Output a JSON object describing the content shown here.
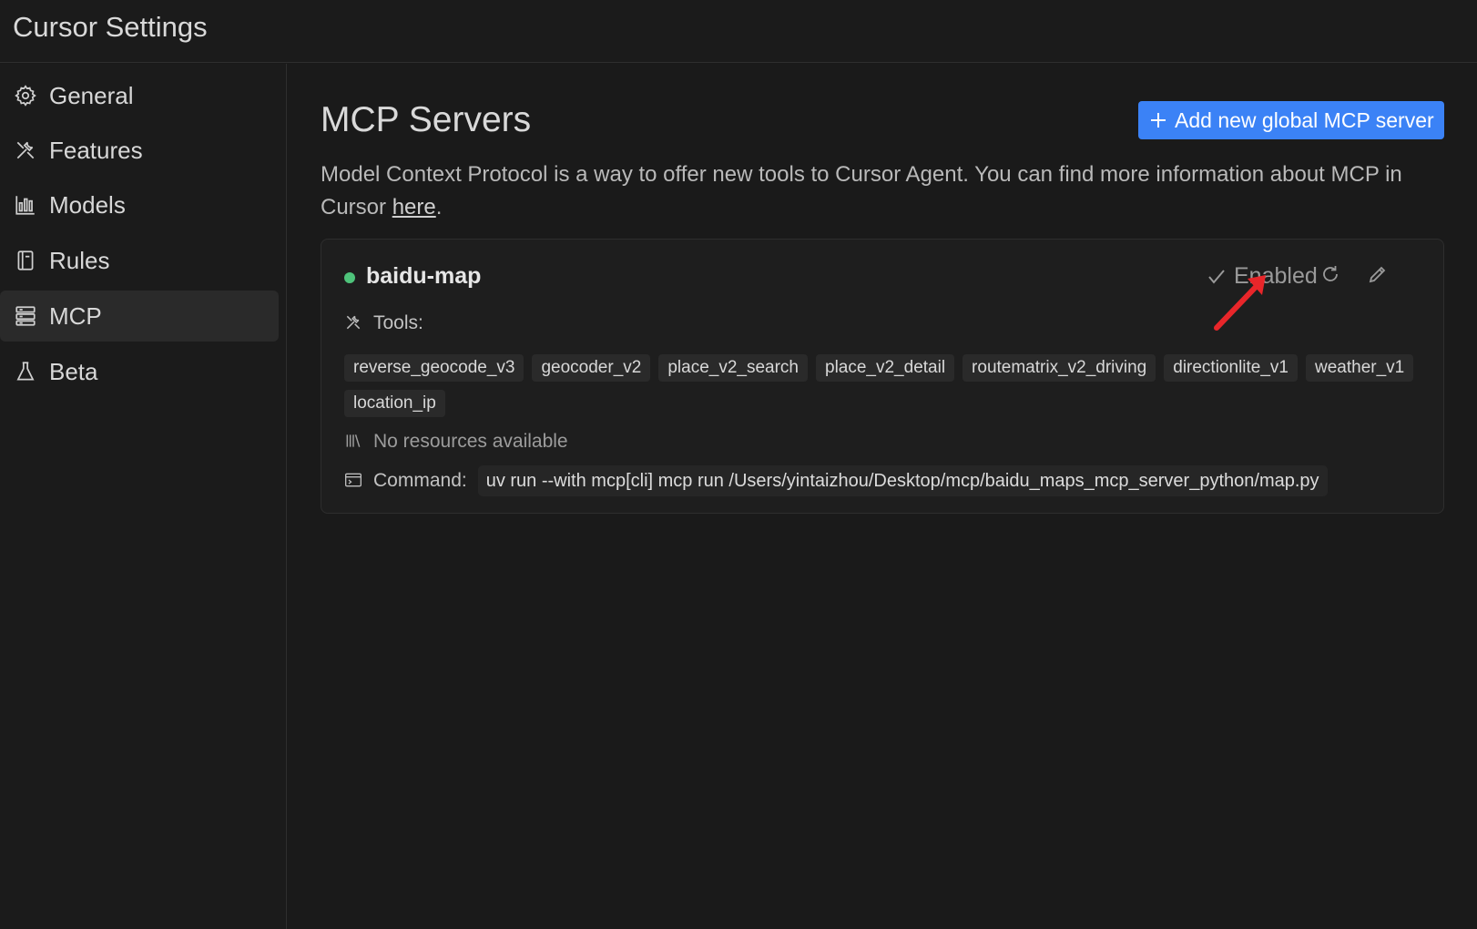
{
  "window": {
    "title": "Cursor Settings"
  },
  "sidebar": {
    "items": [
      {
        "label": "General",
        "icon": "gear-icon",
        "active": false
      },
      {
        "label": "Features",
        "icon": "tools-icon",
        "active": false
      },
      {
        "label": "Models",
        "icon": "bar-chart-icon",
        "active": false
      },
      {
        "label": "Rules",
        "icon": "document-icon",
        "active": false
      },
      {
        "label": "MCP",
        "icon": "server-icon",
        "active": true
      },
      {
        "label": "Beta",
        "icon": "flask-icon",
        "active": false
      }
    ]
  },
  "main": {
    "title": "MCP Servers",
    "add_button_label": "Add new global MCP server",
    "description_text": "Model Context Protocol is a way to offer new tools to Cursor Agent. You can find more information about MCP in Cursor ",
    "description_link": "here",
    "description_end": "."
  },
  "server": {
    "name": "baidu-map",
    "status_color": "#4ec37a",
    "enabled_label": "Enabled",
    "tools_label": "Tools:",
    "tools": [
      "reverse_geocode_v3",
      "geocoder_v2",
      "place_v2_search",
      "place_v2_detail",
      "routematrix_v2_driving",
      "directionlite_v1",
      "weather_v1",
      "location_ip"
    ],
    "resources_label": "No resources available",
    "command_label": "Command:",
    "command_value": "uv run --with mcp[cli] mcp run /Users/yintaizhou/Desktop/mcp/baidu_maps_mcp_server_python/map.py"
  },
  "colors": {
    "accent": "#3b82f6",
    "annotation": "#e8262a"
  }
}
